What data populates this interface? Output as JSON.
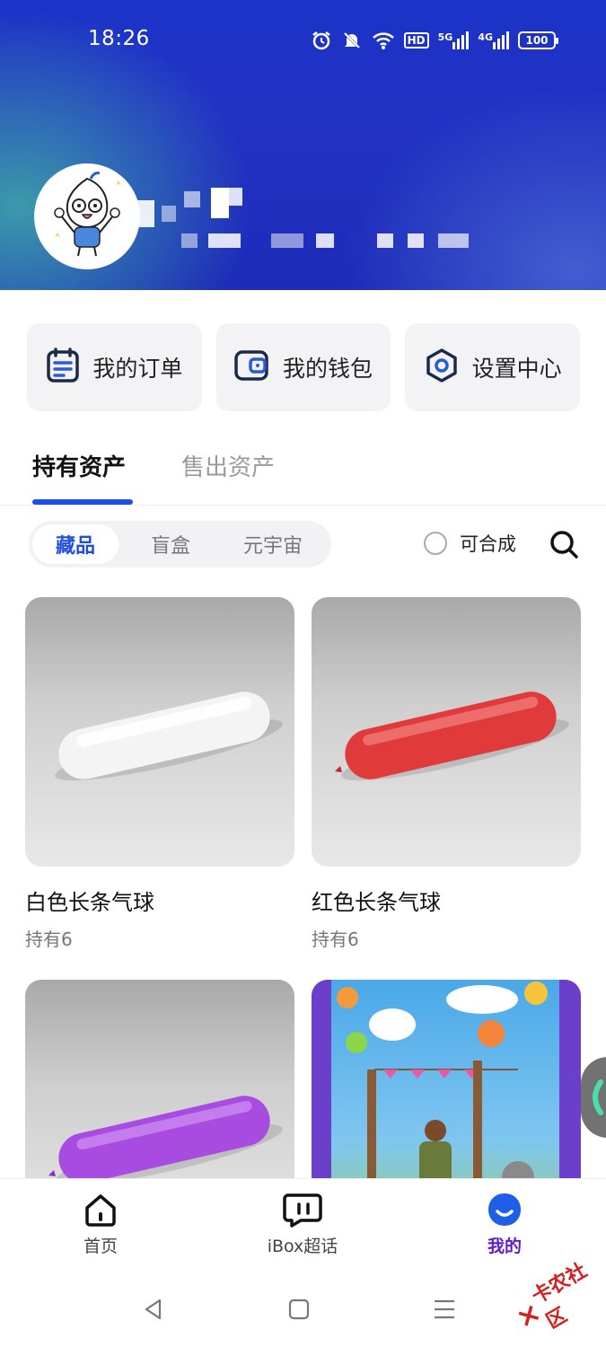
{
  "status_bar": {
    "time": "18:26",
    "battery": "100",
    "signal_1": "5G",
    "signal_2": "4G",
    "hd": "HD"
  },
  "profile": {
    "avatar": "avatar-illustration"
  },
  "shortcuts": [
    {
      "label": "我的订单",
      "icon": "order-icon"
    },
    {
      "label": "我的钱包",
      "icon": "wallet-icon"
    },
    {
      "label": "设置中心",
      "icon": "settings-icon"
    }
  ],
  "tabs": {
    "active": "持有资产",
    "inactive": "售出资产"
  },
  "filter": {
    "segments": [
      "藏品",
      "盲盒",
      "元宇宙"
    ],
    "selected": "藏品",
    "synthesizable_label": "可合成"
  },
  "items": [
    {
      "name": "白色长条气球",
      "count": "持有6",
      "color": "#f2f2f2"
    },
    {
      "name": "红色长条气球",
      "count": "持有6",
      "color": "#e03a3a"
    },
    {
      "name": "",
      "count": "",
      "color": "#a84be0"
    },
    {
      "name": "",
      "count": "",
      "color": ""
    }
  ],
  "bottom_nav": [
    {
      "label": "首页",
      "icon": "home-icon"
    },
    {
      "label": "iBox超话",
      "icon": "chat-icon"
    },
    {
      "label": "我的",
      "icon": "profile-icon",
      "active": true
    }
  ],
  "watermark": "卡农社区",
  "colors": {
    "accent": "#1f4fe0",
    "nav_active": "#5b21c7"
  }
}
